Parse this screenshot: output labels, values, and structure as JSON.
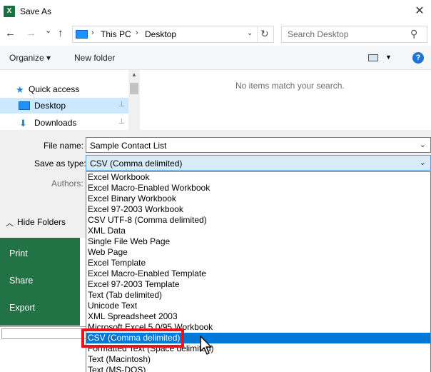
{
  "window": {
    "title": "Save As",
    "app_icon": "excel-icon",
    "close_glyph": "✕"
  },
  "navigation": {
    "back_glyph": "←",
    "forward_glyph": "→",
    "recent_glyph": "⌄",
    "up_glyph": "↑",
    "breadcrumb": [
      "This PC",
      "Desktop"
    ],
    "separator": "›",
    "search_placeholder": "Search Desktop"
  },
  "toolbar": {
    "organize_label": "Organize ▾",
    "new_folder_label": "New folder"
  },
  "nav_pane": {
    "items": [
      {
        "label": "Quick access",
        "icon": "star-icon",
        "glyph": "★"
      },
      {
        "label": "Desktop",
        "icon": "desktop-icon",
        "glyph": ""
      },
      {
        "label": "Downloads",
        "icon": "download-arrow-icon",
        "glyph": "⬇"
      }
    ],
    "pin_glyph": "📌"
  },
  "content": {
    "empty_message": "No items match your search."
  },
  "form": {
    "file_name_label": "File name:",
    "file_name_value": "Sample Contact List",
    "save_as_type_label": "Save as type:",
    "save_as_type_value": "CSV (Comma delimited)",
    "authors_label": "Authors:"
  },
  "hide_folders_label": "Hide Folders",
  "file_types": [
    "Excel Workbook",
    "Excel Macro-Enabled Workbook",
    "Excel Binary Workbook",
    "Excel 97-2003 Workbook",
    "CSV UTF-8 (Comma delimited)",
    "XML Data",
    "Single File Web Page",
    "Web Page",
    "Excel Template",
    "Excel Macro-Enabled Template",
    "Excel 97-2003 Template",
    "Text (Tab delimited)",
    "Unicode Text",
    "XML Spreadsheet 2003",
    "Microsoft Excel 5.0/95 Workbook",
    "CSV (Comma delimited)",
    "Formatted Text (Space delimited)",
    "Text (Macintosh)",
    "Text (MS-DOS)"
  ],
  "highlighted_file_type": "CSV (Comma delimited)",
  "backstage": {
    "items": [
      "Print",
      "Share",
      "Export"
    ]
  },
  "colors": {
    "excel_green": "#217346",
    "selection_blue": "#0078d7",
    "annotation_red": "#e8131b"
  }
}
